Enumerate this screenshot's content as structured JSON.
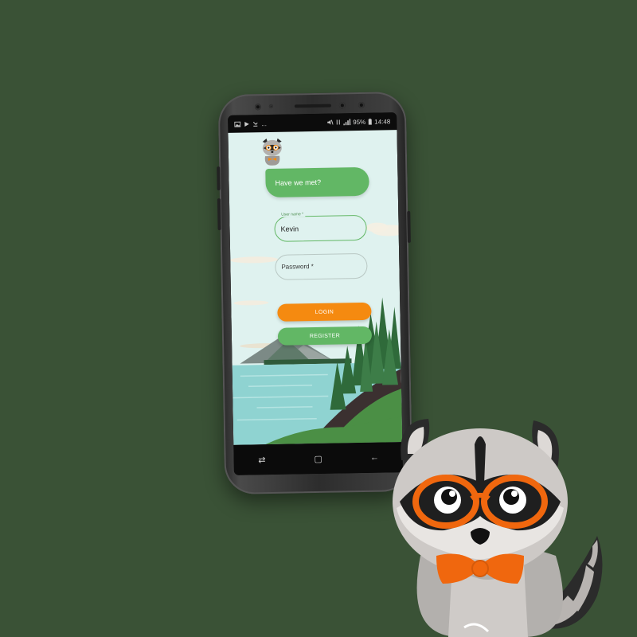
{
  "status_bar": {
    "left_icons": [
      "image-icon",
      "play-icon",
      "missed-call-icon"
    ],
    "left_more": "...",
    "battery": "95%",
    "time": "14:48",
    "right_icons": [
      "mute-icon",
      "data-icon",
      "signal-icon",
      "battery-icon"
    ]
  },
  "app": {
    "greeting": "Have we met?",
    "username": {
      "label": "User name *",
      "value": "Kevin"
    },
    "password": {
      "placeholder": "Password *"
    },
    "login_label": "LOGIN",
    "register_label": "REGISTER"
  },
  "nav_bar": {
    "recent": "⇄",
    "home": "▢",
    "back": "←"
  },
  "colors": {
    "background": "#3a5236",
    "accent_green": "#62b765",
    "accent_orange": "#f58a10",
    "sky": "#dff2ef",
    "lake": "#8fd3d1"
  }
}
